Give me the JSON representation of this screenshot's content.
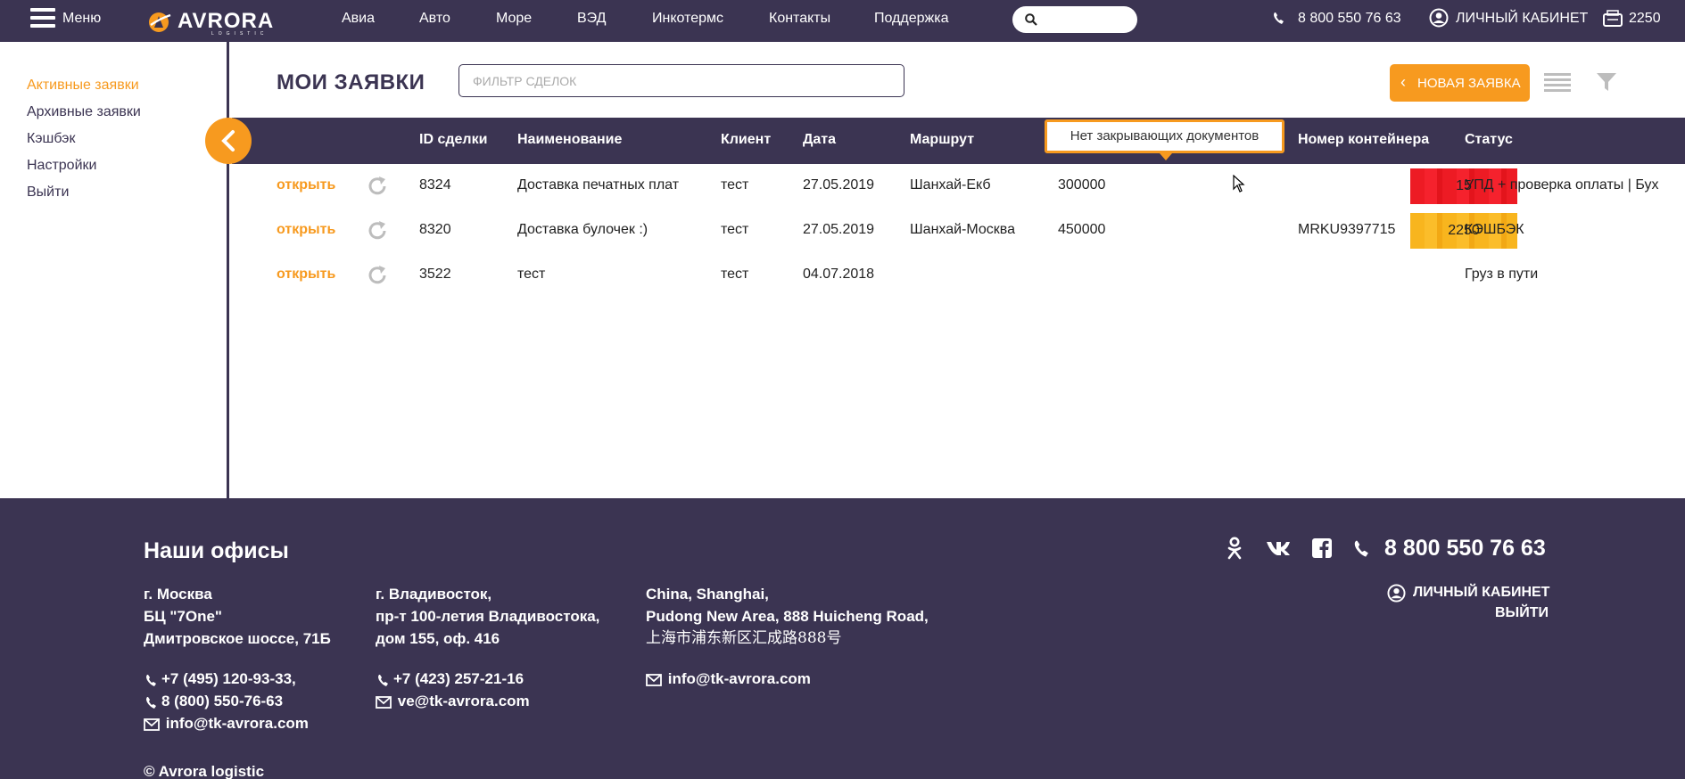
{
  "header": {
    "menu_label": "Меню",
    "logo_text": "AVRORA",
    "logo_sub": "LOGISTIC",
    "nav": [
      "Авиа",
      "Авто",
      "Море",
      "ВЭД",
      "Инкотермс",
      "Контакты",
      "Поддержка"
    ],
    "search_value": "",
    "phone": "8 800 550 76 63",
    "cabinet": "ЛИЧНЫЙ КАБИНЕТ",
    "cashback": "2250"
  },
  "sidebar": {
    "items": [
      "Активные заявки",
      "Архивные заявки",
      "Кэшбэк",
      "Настройки",
      "Выйти"
    ],
    "active_index": 0
  },
  "main": {
    "title": "МОИ ЗАЯВКИ",
    "filter_placeholder": "ФИЛЬТР СДЕЛОК",
    "new_button": "НОВАЯ ЗАЯВКА",
    "columns": [
      "ID сделки",
      "Наименование",
      "Клиент",
      "Дата",
      "Маршрут",
      "Номер контейнера",
      "Статус"
    ],
    "tooltip": "Нет закрывающих документов",
    "open_label": "открыть",
    "rows": [
      {
        "id": "8324",
        "name": "Доставка печатных плат",
        "client": "тест",
        "date": "27.05.2019",
        "route": "Шанхай-Екб",
        "sum": "300000",
        "badge": "15",
        "badge_color": "#ed1b24",
        "container": "",
        "status": "УПД + проверка оплаты | Бух"
      },
      {
        "id": "8320",
        "name": "Доставка булочек :)",
        "client": "тест",
        "date": "27.05.2019",
        "route": "Шанхай-Москва",
        "sum": "450000",
        "badge": "2250",
        "badge_color": "#f8b51e",
        "container": "MRKU9397715",
        "status": "КЭШБЭК"
      },
      {
        "id": "3522",
        "name": "тест",
        "client": "тест",
        "date": "04.07.2018",
        "route": "",
        "sum": "",
        "badge": "",
        "badge_color": "",
        "container": "",
        "status": "Груз в пути"
      }
    ]
  },
  "footer": {
    "heading": "Наши офисы",
    "offices": [
      {
        "address": [
          "г. Москва",
          "БЦ \"7One\"",
          "Дмитровское шоссе, 71Б"
        ],
        "phones": [
          "+7 (495) 120-93-33,",
          "8 (800) 550-76-63"
        ],
        "email": "info@tk-avrora.com"
      },
      {
        "address": [
          "г. Владивосток,",
          "пр-т 100-летия Владивостока,",
          "дом 155, оф. 416"
        ],
        "phones": [
          "+7 (423) 257-21-16"
        ],
        "email": "ve@tk-avrora.com"
      },
      {
        "address": [
          "China, Shanghai,",
          "Pudong New Area, 888 Huicheng Road,",
          "上海市浦东新区汇成路888号"
        ],
        "phones": [],
        "email": "info@tk-avrora.com"
      }
    ],
    "phone": "8 800 550 76 63",
    "cabinet": "ЛИЧНЫЙ КАБИНЕТ",
    "exit": "ВЫЙТИ",
    "copyright": "© Avrora logistic",
    "social_icons": [
      "odnoklassniki-icon",
      "vk-icon",
      "facebook-icon"
    ]
  },
  "colors": {
    "brand_dark": "#3b3452",
    "accent": "#f79a1f"
  }
}
